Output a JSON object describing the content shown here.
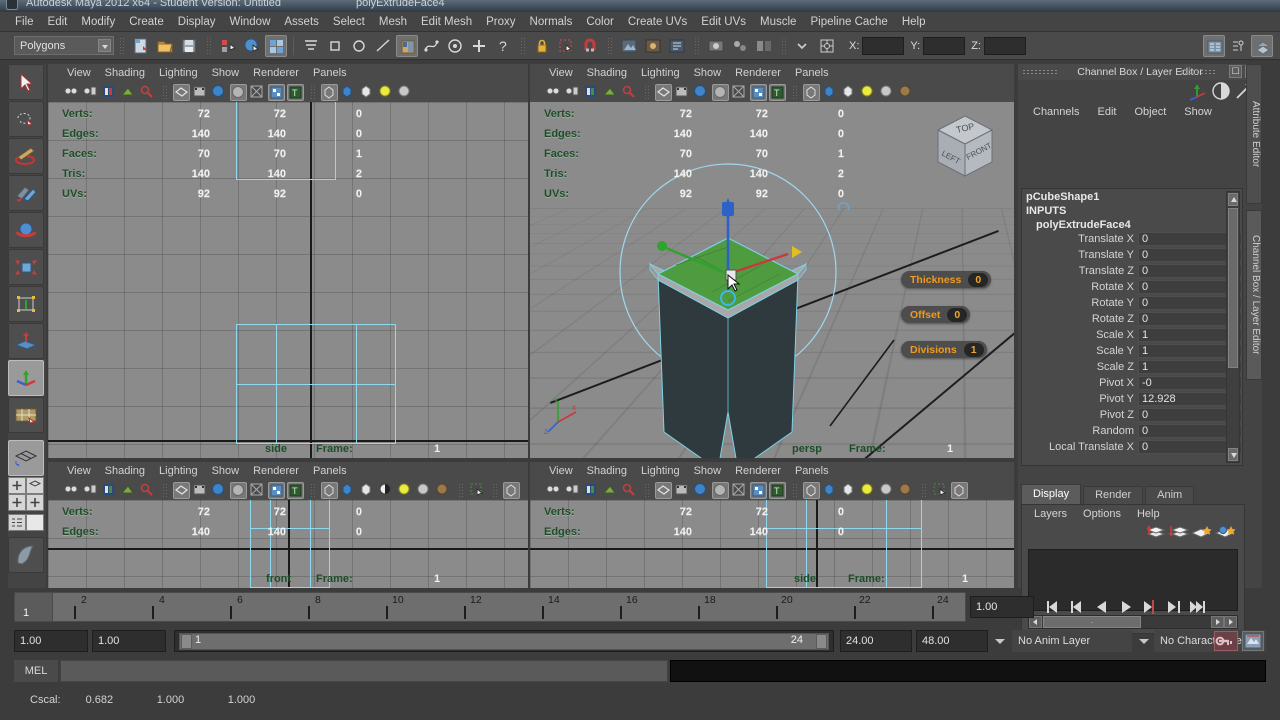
{
  "window": {
    "title": "Autodesk Maya 2012 x64 - Student Version: Untitled",
    "subtitle": "polyExtrudeFace4"
  },
  "menubar": {
    "items": [
      "File",
      "Edit",
      "Modify",
      "Create",
      "Display",
      "Window",
      "Assets",
      "Select",
      "Mesh",
      "Edit Mesh",
      "Proxy",
      "Normals",
      "Color",
      "Create UVs",
      "Edit UVs",
      "Muscle",
      "Pipeline Cache",
      "Help"
    ]
  },
  "statusbar": {
    "mode": "Polygons",
    "coord_labels": [
      "X:",
      "Y:",
      "Z:"
    ],
    "coord_values": [
      "",
      "",
      ""
    ]
  },
  "toolbox": {
    "tools": [
      "select-tool",
      "lasso-tool",
      "paint-select-tool",
      "move-tool",
      "rotate-tool",
      "scale-tool",
      "universal-manip-tool",
      "soft-mod-tool",
      "show-manip-tool",
      "last-tool"
    ]
  },
  "viewports": {
    "panel_menu": [
      "View",
      "Shading",
      "Lighting",
      "Show",
      "Renderer",
      "Panels"
    ],
    "hud_labels": [
      "Verts:",
      "Edges:",
      "Faces:",
      "Tris:",
      "UVs:"
    ],
    "panels": [
      {
        "name": "side-top",
        "label": "side",
        "frame_label": "Frame:",
        "frame_value": "1",
        "hud": [
          {
            "label": "Verts:",
            "a": "72",
            "b": "72",
            "c": "0"
          },
          {
            "label": "Edges:",
            "a": "140",
            "b": "140",
            "c": "0"
          },
          {
            "label": "Faces:",
            "a": "70",
            "b": "70",
            "c": "1"
          },
          {
            "label": "Tris:",
            "a": "140",
            "b": "140",
            "c": "2"
          },
          {
            "label": "UVs:",
            "a": "92",
            "b": "92",
            "c": "0"
          }
        ]
      },
      {
        "name": "persp",
        "label": "persp",
        "frame_label": "Frame:",
        "frame_value": "1",
        "hud": [
          {
            "label": "Verts:",
            "a": "72",
            "b": "72",
            "c": "0"
          },
          {
            "label": "Edges:",
            "a": "140",
            "b": "140",
            "c": "0"
          },
          {
            "label": "Faces:",
            "a": "70",
            "b": "70",
            "c": "1"
          },
          {
            "label": "Tris:",
            "a": "140",
            "b": "140",
            "c": "2"
          },
          {
            "label": "UVs:",
            "a": "92",
            "b": "92",
            "c": "0"
          }
        ],
        "manipulators": [
          {
            "name": "Thickness",
            "value": "0"
          },
          {
            "name": "Offset",
            "value": "0"
          },
          {
            "name": "Divisions",
            "value": "1"
          }
        ],
        "viewcube": {
          "top": "TOP",
          "left": "LEFT",
          "front": "FRONT"
        }
      },
      {
        "name": "front",
        "label": "front",
        "frame_label": "Frame:",
        "frame_value": "1",
        "hud": [
          {
            "label": "Verts:",
            "a": "72",
            "b": "72",
            "c": "0"
          },
          {
            "label": "Edges:",
            "a": "140",
            "b": "140",
            "c": "0"
          }
        ]
      },
      {
        "name": "side-bottom",
        "label": "side",
        "frame_label": "Frame:",
        "frame_value": "1",
        "hud": [
          {
            "label": "Verts:",
            "a": "72",
            "b": "72",
            "c": "0"
          },
          {
            "label": "Edges:",
            "a": "140",
            "b": "140",
            "c": "0"
          }
        ]
      }
    ]
  },
  "channelbox": {
    "title": "Channel Box / Layer Editor",
    "menu": [
      "Channels",
      "Edit",
      "Object",
      "Show"
    ],
    "object_name": "pCubeShape1",
    "inputs_header": "INPUTS",
    "node_name": "polyExtrudeFace4",
    "attributes": [
      {
        "label": "Translate X",
        "value": "0"
      },
      {
        "label": "Translate Y",
        "value": "0"
      },
      {
        "label": "Translate Z",
        "value": "0"
      },
      {
        "label": "Rotate X",
        "value": "0"
      },
      {
        "label": "Rotate Y",
        "value": "0"
      },
      {
        "label": "Rotate Z",
        "value": "0"
      },
      {
        "label": "Scale X",
        "value": "1"
      },
      {
        "label": "Scale Y",
        "value": "1"
      },
      {
        "label": "Scale Z",
        "value": "1"
      },
      {
        "label": "Pivot X",
        "value": "-0"
      },
      {
        "label": "Pivot Y",
        "value": "12.928"
      },
      {
        "label": "Pivot Z",
        "value": "0"
      },
      {
        "label": "Random",
        "value": "0"
      },
      {
        "label": "Local Translate X",
        "value": "0"
      }
    ],
    "side_tabs": [
      "Attribute Editor",
      "Channel Box / Layer Editor"
    ]
  },
  "layereditor": {
    "tabs": [
      {
        "label": "Display",
        "active": true
      },
      {
        "label": "Render",
        "active": false
      },
      {
        "label": "Anim",
        "active": false
      }
    ],
    "menu": [
      "Layers",
      "Options",
      "Help"
    ],
    "layers": []
  },
  "timeline": {
    "ticks": [
      "2",
      "4",
      "6",
      "8",
      "10",
      "12",
      "14",
      "16",
      "18",
      "20",
      "22",
      "24"
    ],
    "current_frame": "1",
    "current_time_field": "1.00",
    "playback_buttons": [
      "go-to-start",
      "step-back-frame",
      "play-backwards",
      "play-forwards",
      "step-forward-frame",
      "go-to-end",
      "go-to-next-key"
    ]
  },
  "rangeslider": {
    "anim_start": "1.00",
    "range_start": "1.00",
    "range_bar_start": "1",
    "range_bar_end": "24",
    "range_end": "24.00",
    "anim_end": "48.00",
    "anim_layer": "No Anim Layer",
    "character_set": "No Character Set"
  },
  "commandline": {
    "language": "MEL",
    "input_value": "",
    "output_value": ""
  },
  "helpline": {
    "label": "Cscal:",
    "values": [
      "0.682",
      "1.000",
      "1.000"
    ]
  },
  "colors": {
    "hud_green": "#1c4f28",
    "manip_orange": "#f09a1e",
    "wire_cyan": "#8ed8f0",
    "selection_green": "#4f9b3f",
    "panel_bg": "#444444",
    "viewport_bg": "#8b8b8b"
  }
}
